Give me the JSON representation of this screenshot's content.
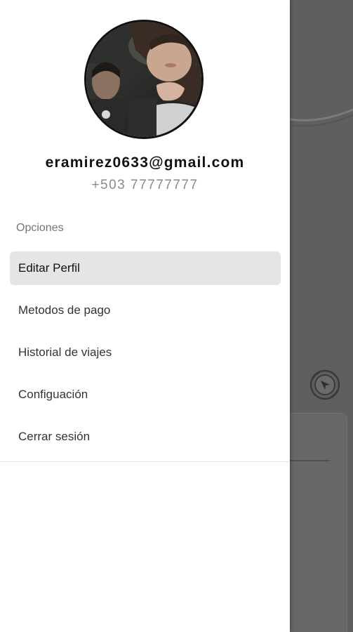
{
  "user": {
    "email": "eramirez0633@gmail.com",
    "phone": "+503 77777777"
  },
  "drawer": {
    "section_title": "Opciones",
    "items": [
      {
        "label": "Editar Perfil",
        "active": true
      },
      {
        "label": "Metodos de pago",
        "active": false
      },
      {
        "label": "Historial de viajes",
        "active": false
      },
      {
        "label": "Configuación",
        "active": false
      },
      {
        "label": "Cerrar sesión",
        "active": false
      }
    ]
  },
  "colors": {
    "drawer_bg": "#ffffff",
    "active_item_bg": "#e7e4e7",
    "scrim": "#5f5f5f"
  },
  "icons": {
    "locate": "navigation-arrow-icon"
  }
}
